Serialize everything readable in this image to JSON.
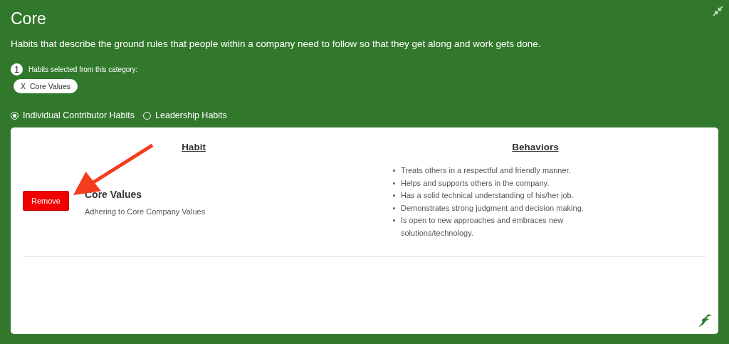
{
  "title": "Core",
  "description": "Habits that describe the ground rules that people within a company need to follow so that they get along and work gets done.",
  "selection": {
    "count": "1",
    "label": "Habits selected from this category:",
    "chips": [
      {
        "icon": "X",
        "label": "Core Values"
      }
    ]
  },
  "radios": [
    {
      "label": "Individual Contributor Habits",
      "selected": true
    },
    {
      "label": "Leadership Habits",
      "selected": false
    }
  ],
  "table": {
    "columns": [
      "Habit",
      "Behaviors"
    ],
    "rows": [
      {
        "button": "Remove",
        "name": "Core Values",
        "description": "Adhering to Core Company Values",
        "behaviors": [
          "Treats others in a respectful and friendly manner.",
          "Helps and supports others in the company.",
          "Has a solid technical understanding of his/her job.",
          "Demonstrates strong judgment and decision making.",
          "Is open to new approaches and embraces new solutions/technology."
        ]
      }
    ]
  }
}
